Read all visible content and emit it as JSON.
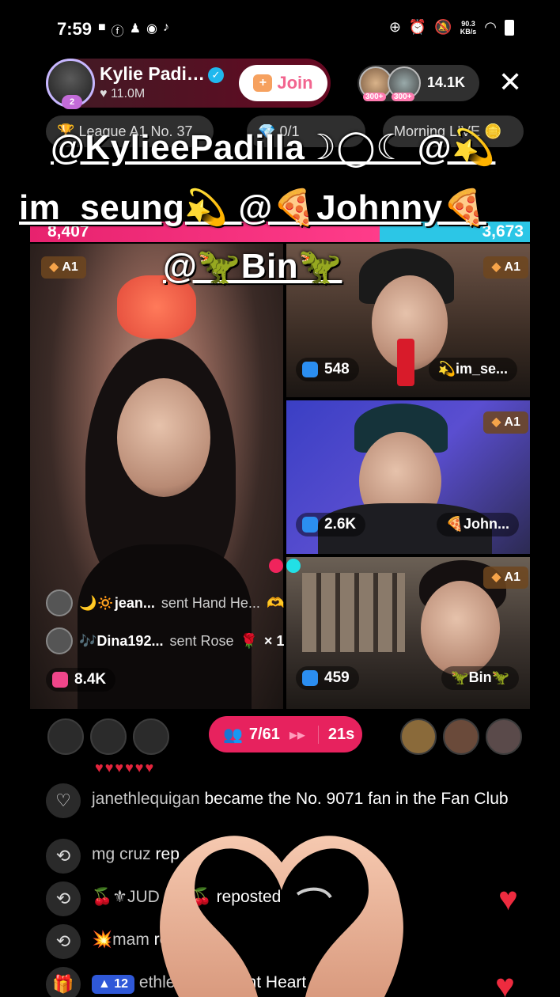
{
  "status": {
    "time": "7:59",
    "network_speed": "90.3",
    "network_unit": "KB/s"
  },
  "host": {
    "name": "Kylie Padi…",
    "likes": "11.0M",
    "avatar_badge": "2",
    "join_label": "Join"
  },
  "viewers": {
    "count": "14.1K",
    "badges": [
      "300+",
      "300+"
    ]
  },
  "info_chips": {
    "league": "League A1 No. 37",
    "rank": "0/1",
    "morning": "Morning LIVE"
  },
  "mentions": {
    "line1": "@KylieePadilla☽◯☾ @💫",
    "line2": "im_seung💫 @🍕Johnny🍕",
    "line3": "@🦖Bin🦖"
  },
  "battle": {
    "left_score": "8,407",
    "right_score": "3,673",
    "left_fraction": 0.7
  },
  "tiles": [
    {
      "rank": "A1",
      "score": "8.4K",
      "name": ""
    },
    {
      "rank": "A1",
      "score": "548",
      "name": "💫im_se..."
    },
    {
      "rank": "A1",
      "score": "2.6K",
      "name": "🍕John..."
    },
    {
      "rank": "A1",
      "score": "459",
      "name": "🦖Bin🦖"
    }
  ],
  "gifts": [
    {
      "user": "🌙🔅jean...",
      "action": "sent Hand He...",
      "multiplier": ""
    },
    {
      "user": "🎶Dina192...",
      "action": "sent Rose",
      "multiplier": "× 1"
    }
  ],
  "team": {
    "members": "7/61",
    "timer": "21s"
  },
  "chat": [
    {
      "icon": "heart-outline-icon",
      "user": "janethlequigan",
      "text": "became the No. 9071 fan in the Fan Club"
    },
    {
      "icon": "repost-icon",
      "user": "mg cruz",
      "text": "rep"
    },
    {
      "icon": "repost-icon",
      "user": "🍒⚜JUD",
      "text": "N⚜🍒 reposted"
    },
    {
      "icon": "repost-icon",
      "user": "💥mam",
      "text": "reposte"
    },
    {
      "icon": "gift-icon",
      "user": "ethlequigan",
      "text": "sent Heart",
      "level": "12",
      "multiplier": "× 1"
    }
  ],
  "colors": {
    "accent_pink": "#e7225e",
    "battle_blue": "#2cc6e6",
    "join_text": "#f2658f"
  }
}
